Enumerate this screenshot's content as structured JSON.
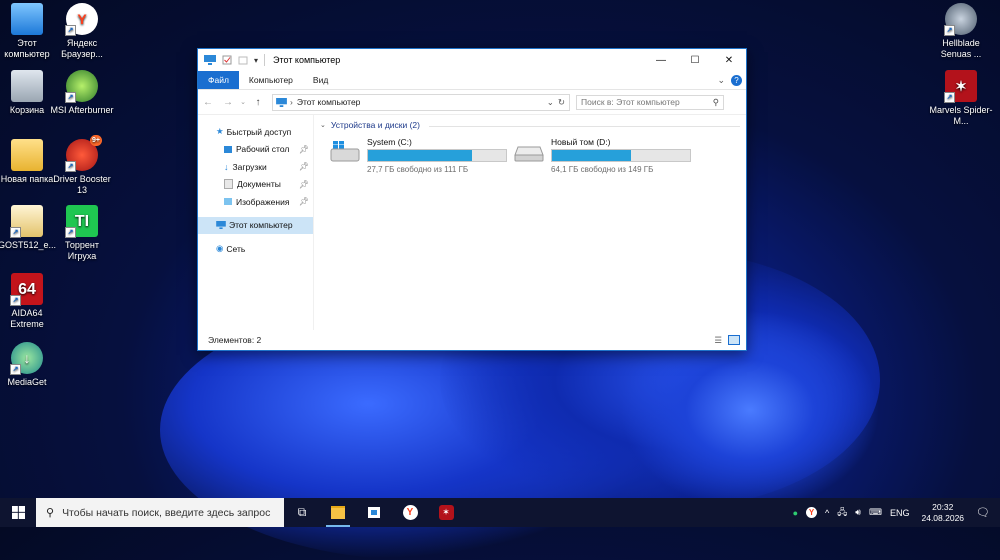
{
  "desktop": {
    "icons_left": [
      {
        "label": "Этот компьютер",
        "icon": "computer-icon"
      },
      {
        "label": "Яндекс Браузер...",
        "icon": "yandex-browser-icon"
      },
      {
        "label": "Корзина",
        "icon": "recycle-bin-icon"
      },
      {
        "label": "MSI Afterburner",
        "icon": "msi-afterburner-icon"
      },
      {
        "label": "Новая папка",
        "icon": "folder-icon"
      },
      {
        "label": "Driver Booster 13",
        "icon": "driver-booster-icon",
        "badge": "9+"
      },
      {
        "label": "GOST512_e...",
        "icon": "certificate-icon"
      },
      {
        "label": "Торрент Игруха",
        "icon": "torrent-igruha-icon",
        "glyph": "TI"
      },
      {
        "label": "AIDA64 Extreme",
        "icon": "aida64-icon",
        "glyph": "64"
      },
      {
        "label": "MediaGet",
        "icon": "mediaget-icon"
      }
    ],
    "icons_right": [
      {
        "label": "Hellblade Senuas ...",
        "icon": "hellblade-icon"
      },
      {
        "label": "Marvels Spider-M...",
        "icon": "spider-man-icon"
      }
    ]
  },
  "explorer": {
    "title": "Этот компьютер",
    "ribbon_tabs": [
      "Файл",
      "Компьютер",
      "Вид"
    ],
    "address": "Этот компьютер",
    "search_placeholder": "Поиск в: Этот компьютер",
    "nav": {
      "quick_access": "Быстрый доступ",
      "pinned": [
        "Рабочий стол",
        "Загрузки",
        "Документы",
        "Изображения"
      ],
      "this_pc": "Этот компьютер",
      "network": "Сеть"
    },
    "group_header": "Устройства и диски (2)",
    "drives": [
      {
        "name": "System (C:)",
        "free": "27,7 ГБ свободно из 111 ГБ",
        "used_fraction": 0.75
      },
      {
        "name": "Новый том (D:)",
        "free": "64,1 ГБ свободно из 149 ГБ",
        "used_fraction": 0.57
      }
    ],
    "status": "Элементов: 2"
  },
  "taskbar": {
    "search_placeholder": "Чтобы начать поиск, введите здесь запрос",
    "lang": "ENG",
    "time": "20:32",
    "date": "24.08.2026"
  },
  "colors": {
    "accent": "#1a6ed0",
    "drive_fill": "#26a0da",
    "taskbar": "#0e1430"
  }
}
